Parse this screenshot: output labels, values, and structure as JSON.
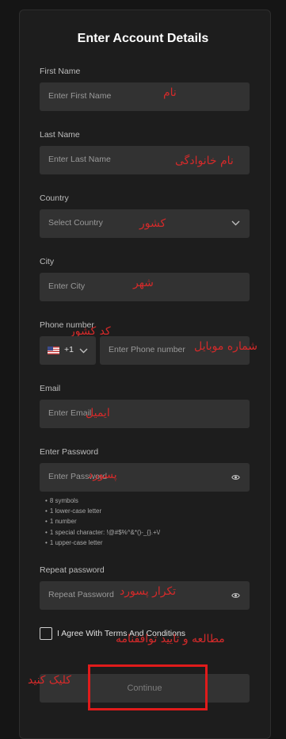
{
  "form": {
    "title": "Enter Account Details",
    "first_name": {
      "label": "First Name",
      "placeholder": "Enter First Name"
    },
    "last_name": {
      "label": "Last Name",
      "placeholder": "Enter Last Name"
    },
    "country": {
      "label": "Country",
      "placeholder": "Select Country"
    },
    "city": {
      "label": "City",
      "placeholder": "Enter City"
    },
    "phone": {
      "label": "Phone number",
      "code": "+1",
      "placeholder": "Enter Phone number"
    },
    "email": {
      "label": "Email",
      "placeholder": "Enter Email"
    },
    "password": {
      "label": "Enter Password",
      "placeholder": "Enter Password",
      "requirements": [
        "8 symbols",
        "1 lower-case letter",
        "1 number",
        "1 special character: !@#$%^&*()-_{}.+\\/",
        "1 upper-case letter"
      ]
    },
    "repeat_password": {
      "label": "Repeat password",
      "placeholder": "Repeat Password"
    },
    "terms_label": "I Agree With Terms And Conditions",
    "continue_label": "Continue"
  },
  "annotations": {
    "first_name": "نام",
    "last_name": "نام خانوادگی",
    "country": "کشور",
    "city": "شهر",
    "country_code": "کد کشور",
    "mobile": "شماره موبایل",
    "email": "ایمیل",
    "password": "پسورد",
    "repeat_password": "تکرار پسورد",
    "terms": "مطالعه و تایید توافقنامه",
    "click": "کلیک کنید"
  },
  "colors": {
    "background": "#151515",
    "panel": "#1d1d1d",
    "field": "#323232",
    "annotation_red": "#d42a2a"
  },
  "icons": {
    "country_dropdown": "chevron-down-icon",
    "phone_code_dropdown": "chevron-down-icon",
    "password_toggle": "eye-icon",
    "flag": "us-flag-icon"
  }
}
